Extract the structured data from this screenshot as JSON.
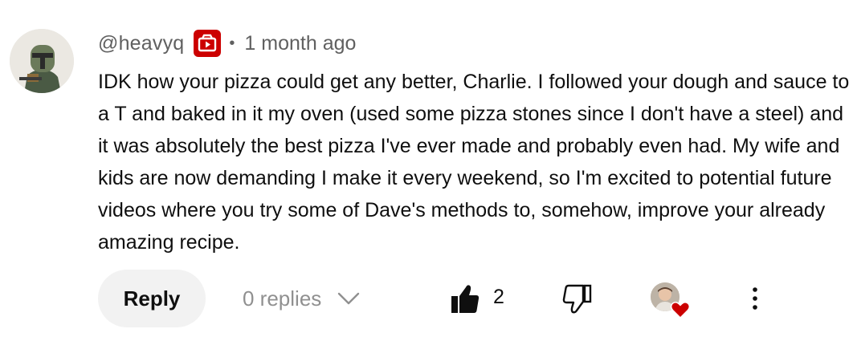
{
  "comment": {
    "author_handle": "@heavyq",
    "badge_icon": "youtube-member-icon",
    "separator": "•",
    "time_ago": "1 month ago",
    "text": "IDK how your pizza could get any better, Charlie. I followed your dough and sauce to a T and baked in it my oven (used some pizza stones since I don't have a steel) and it was absolutely the best pizza I've ever made and probably even had. My wife and kids are now demanding I make it every weekend, so I'm excited to potential future videos where you try some of Dave's methods to, somehow, improve your already amazing recipe."
  },
  "actions": {
    "reply_label": "Reply",
    "replies_label": "0 replies",
    "like_count": "2"
  },
  "colors": {
    "badge_red": "#cc0000",
    "heart_red": "#cc0000",
    "reply_bg": "#f2f2f2",
    "muted_text": "#606060"
  }
}
